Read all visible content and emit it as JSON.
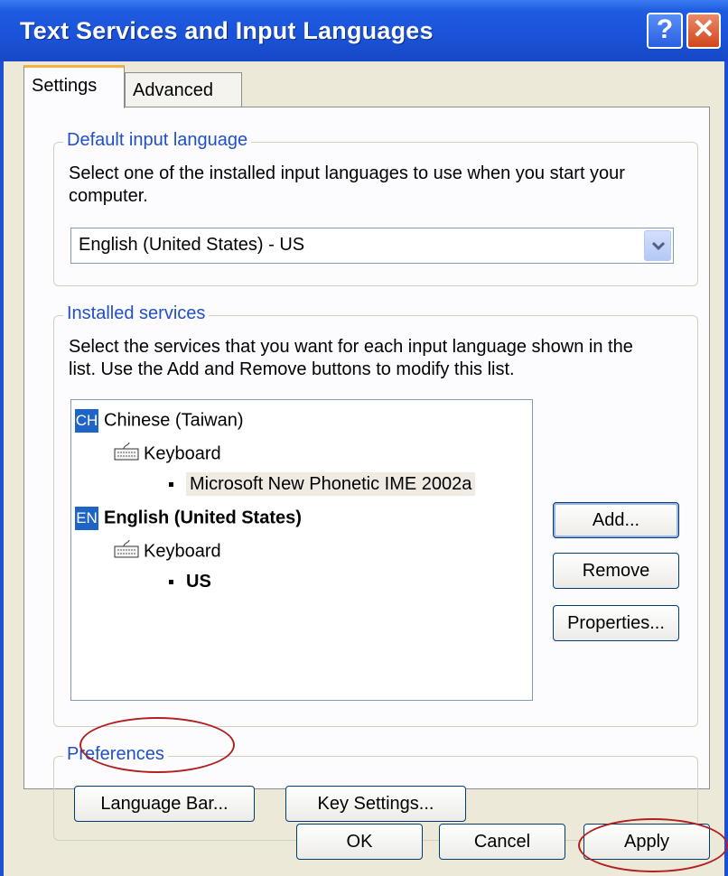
{
  "window": {
    "title": "Text Services and Input Languages",
    "help_glyph": "?",
    "close_glyph": "✕"
  },
  "tabs": [
    {
      "label": "Settings",
      "active": true
    },
    {
      "label": "Advanced",
      "active": false
    }
  ],
  "default_input": {
    "legend": "Default input language",
    "description_line1": "Select one of the installed input languages to use when you start your",
    "description_line2": "computer.",
    "selected": "English (United States) - US"
  },
  "installed": {
    "legend": "Installed services",
    "description_line1": "Select the services that you want for each input language shown in the",
    "description_line2": "list. Use the Add and Remove buttons to modify this list.",
    "tree": {
      "lang1": {
        "badge": "CH",
        "name": "Chinese (Taiwan)",
        "group": "Keyboard",
        "item": "Microsoft New Phonetic IME 2002a"
      },
      "lang2": {
        "badge": "EN",
        "name": "English (United States)",
        "group": "Keyboard",
        "item": "US"
      }
    },
    "buttons": {
      "add": "Add...",
      "remove": "Remove",
      "properties": "Properties..."
    }
  },
  "preferences": {
    "legend": "Preferences",
    "language_bar": "Language Bar...",
    "key_settings": "Key Settings..."
  },
  "footer": {
    "ok": "OK",
    "cancel": "Cancel",
    "apply": "Apply"
  },
  "colors": {
    "title_bar": "#1f4fd1",
    "legend_text": "#1f50c8",
    "annotation_ring": "#b02020"
  },
  "icons": {
    "keyboard": "keyboard-icon",
    "dropdown": "chevron-down-icon",
    "help": "help-icon",
    "close": "close-icon"
  }
}
